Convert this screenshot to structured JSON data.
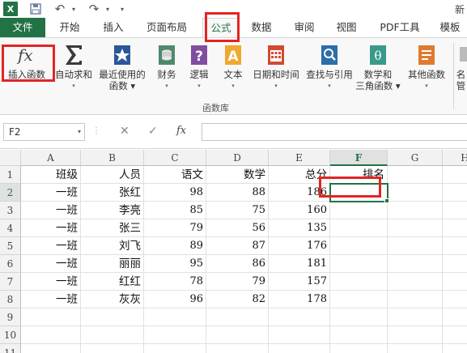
{
  "titlebar": {
    "app_icon": "X",
    "title": "新"
  },
  "tabs": [
    "文件",
    "开始",
    "插入",
    "页面布局",
    "公式",
    "数据",
    "审阅",
    "视图",
    "PDF工具",
    "模板"
  ],
  "ribbon": {
    "buttons": [
      {
        "label1": "插入函数",
        "label2": "",
        "icon": "fx-icon"
      },
      {
        "label1": "自动求和",
        "label2": "▾",
        "icon": "sigma-icon"
      },
      {
        "label1": "最近使用的",
        "label2": "函数 ▾",
        "icon": "star-book-icon"
      },
      {
        "label1": "财务",
        "label2": "▾",
        "icon": "finance-icon"
      },
      {
        "label1": "逻辑",
        "label2": "▾",
        "icon": "logic-icon"
      },
      {
        "label1": "文本",
        "label2": "▾",
        "icon": "text-icon"
      },
      {
        "label1": "日期和时间",
        "label2": "▾",
        "icon": "calendar-icon"
      },
      {
        "label1": "查找与引用",
        "label2": "▾",
        "icon": "lookup-icon"
      },
      {
        "label1": "数学和",
        "label2": "三角函数 ▾",
        "icon": "math-icon"
      },
      {
        "label1": "其他函数",
        "label2": "▾",
        "icon": "more-functions-icon"
      },
      {
        "label1": "名",
        "label2": "管",
        "icon": "name-manager-icon"
      }
    ],
    "group_label": "函数库"
  },
  "formula_bar": {
    "name_box": "F2",
    "fx": "fx",
    "cancel": "✕",
    "enter": "✓",
    "value": ""
  },
  "grid": {
    "columns": [
      "A",
      "B",
      "C",
      "D",
      "E",
      "F",
      "G",
      "H"
    ],
    "selected_column": "F",
    "rows": [
      "1",
      "2",
      "3",
      "4",
      "5",
      "6",
      "7",
      "8",
      "9",
      "10",
      "11"
    ],
    "selected_row": "2",
    "headers": [
      "班级",
      "人员",
      "语文",
      "数学",
      "总分",
      "排名"
    ],
    "data": [
      [
        "一班",
        "张红",
        "98",
        "88",
        "186"
      ],
      [
        "一班",
        "李亮",
        "85",
        "75",
        "160"
      ],
      [
        "一班",
        "张三",
        "79",
        "56",
        "135"
      ],
      [
        "一班",
        "刘飞",
        "89",
        "87",
        "176"
      ],
      [
        "一班",
        "丽丽",
        "95",
        "86",
        "181"
      ],
      [
        "一班",
        "红红",
        "78",
        "79",
        "157"
      ],
      [
        "一班",
        "灰灰",
        "96",
        "82",
        "178"
      ]
    ]
  },
  "colors": {
    "accent": "#217346",
    "highlight": "#e32424"
  }
}
